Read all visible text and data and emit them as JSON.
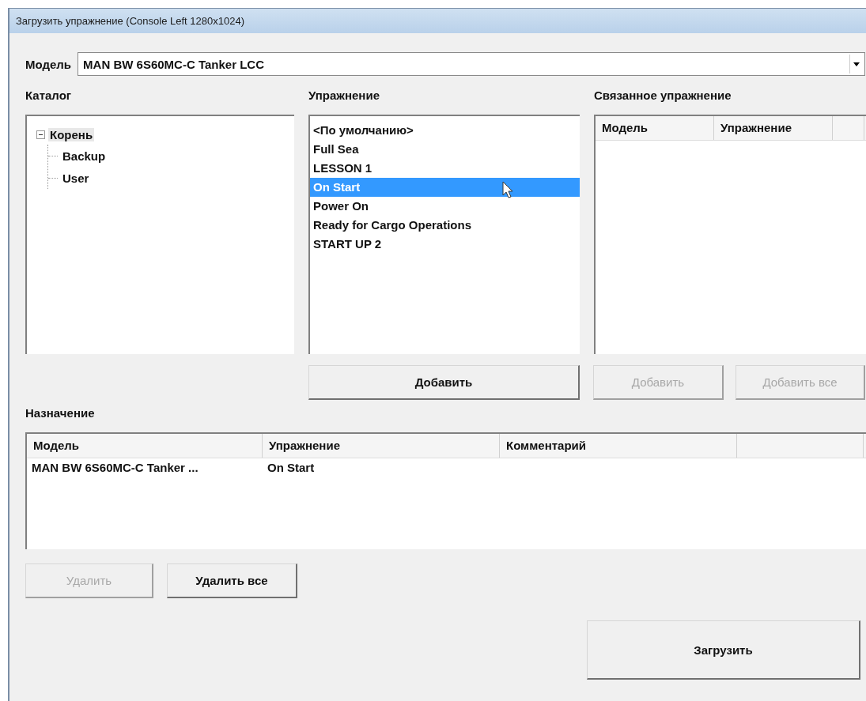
{
  "window": {
    "title": "Загрузить упражнение (Console Left 1280x1024)"
  },
  "model": {
    "label": "Модель",
    "value": "MAN BW 6S60MC-C Tanker LCC"
  },
  "catalog": {
    "heading": "Каталог",
    "tree": [
      {
        "label": "Корень",
        "expanded": true,
        "selected": true,
        "children": [
          {
            "label": "Backup",
            "selected": false
          },
          {
            "label": "User",
            "selected": false
          }
        ]
      }
    ]
  },
  "exercise": {
    "heading": "Упражнение",
    "items": [
      {
        "label": "<По умолчанию>",
        "selected": false
      },
      {
        "label": "Full Sea",
        "selected": false
      },
      {
        "label": "LESSON 1",
        "selected": false
      },
      {
        "label": "On Start",
        "selected": true
      },
      {
        "label": "Power On",
        "selected": false
      },
      {
        "label": "Ready for Cargo Operations",
        "selected": false
      },
      {
        "label": "START UP 2",
        "selected": false
      }
    ],
    "add_button": {
      "label": "Добавить",
      "disabled": false
    }
  },
  "linked": {
    "heading": "Связанное упражнение",
    "columns": [
      "Модель",
      "Упражнение"
    ],
    "buttons": [
      {
        "label": "Добавить",
        "disabled": true
      },
      {
        "label": "Добавить все",
        "disabled": true
      }
    ]
  },
  "assignment": {
    "heading": "Назначение",
    "columns": [
      "Модель",
      "Упражнение",
      "Комментарий"
    ],
    "rows": [
      {
        "cells": [
          "MAN BW 6S60MC-C Tanker ...",
          "On Start"
        ]
      }
    ]
  },
  "remove_buttons": [
    {
      "label": "Удалить",
      "disabled": true
    },
    {
      "label": "Удалить все",
      "disabled": false
    }
  ],
  "load_button": {
    "label": "Загрузить",
    "disabled": false
  }
}
